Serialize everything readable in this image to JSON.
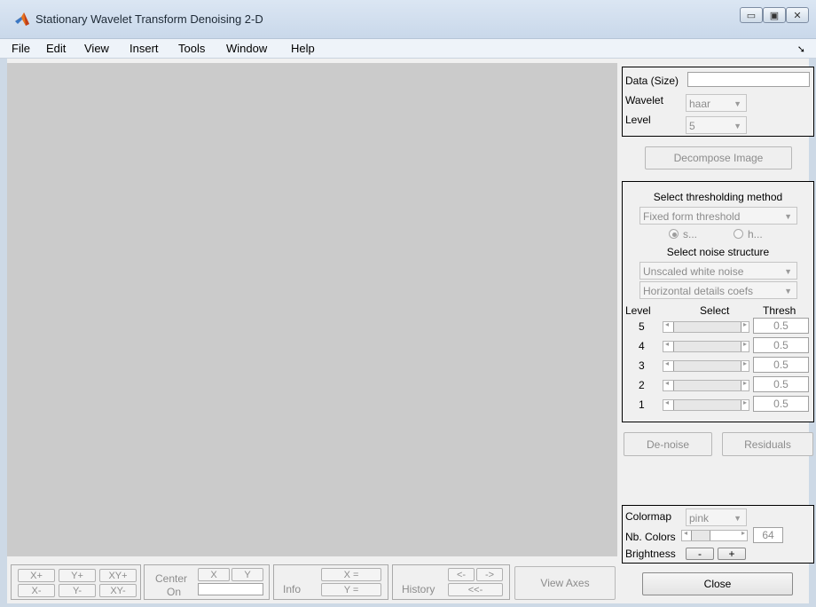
{
  "window": {
    "title": "Stationary Wavelet Transform Denoising 2-D",
    "controls": [
      "minimize",
      "maximize",
      "close"
    ]
  },
  "menu": [
    "File",
    "Edit",
    "View",
    "Insert",
    "Tools",
    "Window",
    "Help"
  ],
  "data_panel": {
    "data_label": "Data  (Size)",
    "data_value": "",
    "wavelet_label": "Wavelet",
    "wavelet_value": "haar",
    "level_label": "Level",
    "level_value": "5"
  },
  "decompose_button": "Decompose Image",
  "threshold_panel": {
    "method_title": "Select thresholding method",
    "method_value": "Fixed form threshold",
    "soft_label": "s...",
    "hard_label": "h...",
    "noise_title": "Select noise structure",
    "noise_value": "Unscaled white noise",
    "coefs_value": "Horizontal details coefs",
    "col_level": "Level",
    "col_select": "Select",
    "col_thresh": "Thresh",
    "rows": [
      {
        "level": "5",
        "thresh": "0.5"
      },
      {
        "level": "4",
        "thresh": "0.5"
      },
      {
        "level": "3",
        "thresh": "0.5"
      },
      {
        "level": "2",
        "thresh": "0.5"
      },
      {
        "level": "1",
        "thresh": "0.5"
      }
    ]
  },
  "denoise_button": "De-noise",
  "residuals_button": "Residuals",
  "color_panel": {
    "colormap_label": "Colormap",
    "colormap_value": "pink",
    "nbcolors_label": "Nb. Colors",
    "nbcolors_value": "64",
    "brightness_label": "Brightness",
    "minus": "-",
    "plus": "+"
  },
  "close_button": "Close",
  "toolbar": {
    "xplus": "X+",
    "yplus": "Y+",
    "xyplus": "XY+",
    "xminus": "X-",
    "yminus": "Y-",
    "xyminus": "XY-",
    "center_label_1": "Center",
    "center_label_2": "On",
    "center_x": "X",
    "center_y": "Y",
    "info_label": "Info",
    "x_eq": "X =",
    "y_eq": "Y =",
    "history_label": "History",
    "back": "<-",
    "forward": "->",
    "back_all": "<<-",
    "view_axes": "View Axes"
  }
}
